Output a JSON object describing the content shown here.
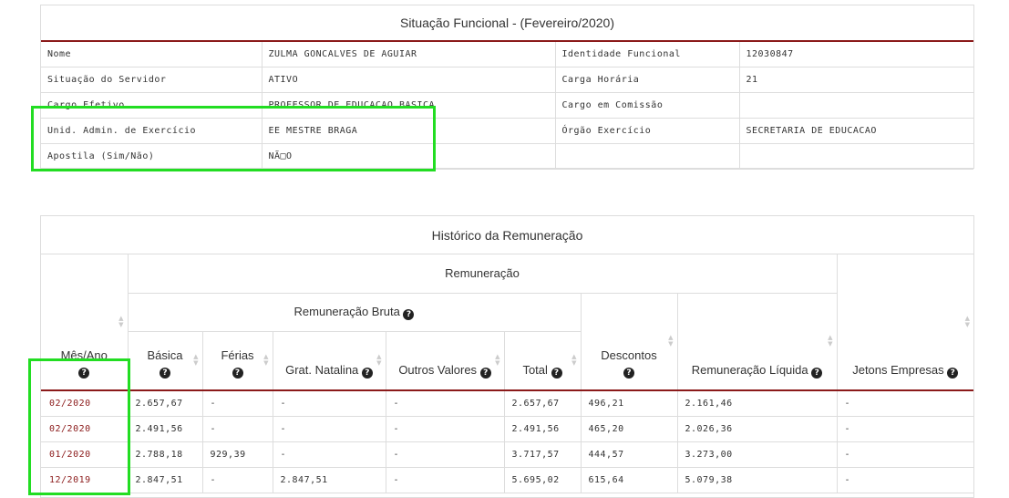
{
  "situacao": {
    "title": "Situação Funcional - (Fevereiro/2020)",
    "rows": [
      [
        "Nome",
        "ZULMA GONCALVES DE AGUIAR",
        "Identidade Funcional",
        "12030847"
      ],
      [
        "Situação do Servidor",
        "ATIVO",
        "Carga Horária",
        "21"
      ],
      [
        "Cargo Efetivo",
        "PROFESSOR DE EDUCACAO BASICA",
        "Cargo em Comissão",
        ""
      ],
      [
        "Unid. Admin. de Exercício",
        "EE MESTRE BRAGA",
        "Órgão Exercício",
        "SECRETARIA DE EDUCACAO"
      ],
      [
        "Apostila (Sim/Não)",
        "NÃ□O",
        "",
        ""
      ]
    ]
  },
  "historico": {
    "title": "Histórico da Remuneração",
    "headers": {
      "remuneracao": "Remuneração",
      "remuneracao_bruta": "Remuneração Bruta",
      "mes_ano": "Mês/Ano",
      "basica": "Básica",
      "ferias": "Férias",
      "grat_natalina": "Grat. Natalina",
      "outros_valores": "Outros Valores",
      "total": "Total",
      "descontos": "Descontos",
      "remuneracao_liquida": "Remuneração Líquida",
      "jetons": "Jetons Empresas"
    },
    "rows": [
      [
        "02/2020",
        "2.657,67",
        "-",
        "-",
        "-",
        "2.657,67",
        "496,21",
        "2.161,46",
        "-"
      ],
      [
        "02/2020",
        "2.491,56",
        "-",
        "-",
        "-",
        "2.491,56",
        "465,20",
        "2.026,36",
        "-"
      ],
      [
        "01/2020",
        "2.788,18",
        "929,39",
        "-",
        "-",
        "3.717,57",
        "444,57",
        "3.273,00",
        "-"
      ],
      [
        "12/2019",
        "2.847,51",
        "-",
        "2.847,51",
        "-",
        "5.695,02",
        "615,64",
        "5.079,38",
        "-"
      ]
    ]
  },
  "icons": {
    "help": "question-circle-icon",
    "sort": "sort-arrows-icon"
  },
  "colors": {
    "accent": "#8b1a1a",
    "highlight": "#22dd22"
  }
}
